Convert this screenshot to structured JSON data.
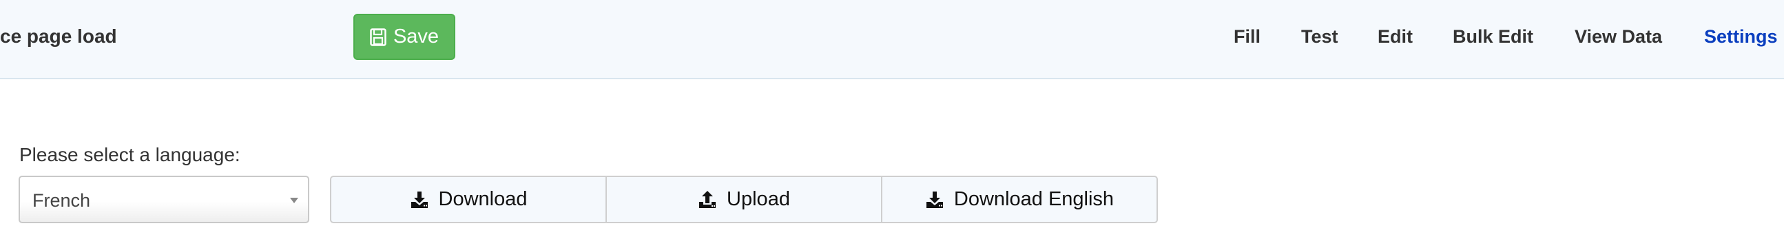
{
  "header": {
    "form_title": "ce page load",
    "save_label": "Save",
    "nav": [
      {
        "label": "Fill",
        "active": false
      },
      {
        "label": "Test",
        "active": false
      },
      {
        "label": "Edit",
        "active": false
      },
      {
        "label": "Bulk Edit",
        "active": false
      },
      {
        "label": "View Data",
        "active": false
      },
      {
        "label": "Settings",
        "active": true
      }
    ],
    "colors": {
      "save": "#5cb85c",
      "active_nav": "#0b3fbf",
      "topbar_bg": "#f5f9fd"
    }
  },
  "language": {
    "label": "Please select a language:",
    "selected": "French"
  },
  "actions": {
    "download": {
      "label": "Download",
      "icon": "download-icon"
    },
    "upload": {
      "label": "Upload",
      "icon": "upload-icon"
    },
    "download_english": {
      "label": "Download English",
      "icon": "download-icon"
    }
  }
}
